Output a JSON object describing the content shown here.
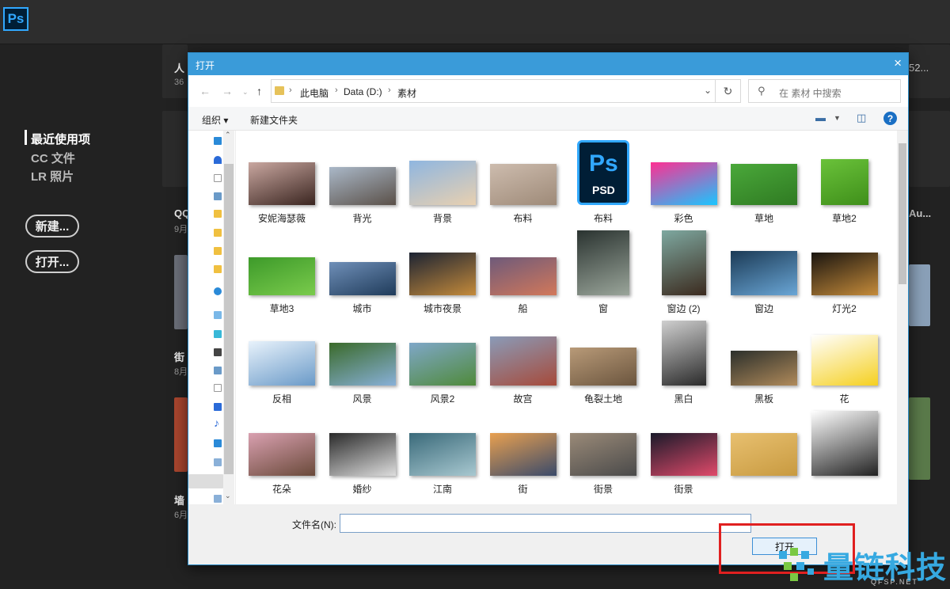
{
  "app": {
    "logo": "Ps"
  },
  "sidebar": {
    "items": [
      {
        "label": "最近使用项",
        "active": true
      },
      {
        "label": "CC 文件",
        "active": false
      },
      {
        "label": "LR 照片",
        "active": false
      }
    ],
    "new_label": "新建...",
    "open_label": "打开..."
  },
  "cards": [
    {
      "name": "人",
      "sub": "36",
      "id": "c1"
    },
    {
      "name": "QQ",
      "sub": "9月",
      "id": "c2"
    },
    {
      "name": "街",
      "sub": "8月",
      "id": "c3"
    },
    {
      "name": "墙",
      "sub": "6月",
      "id": "c4"
    },
    {
      "name": "52...",
      "sub": "",
      "id": "c5"
    },
    {
      "name": "Au...",
      "sub": "",
      "id": "c6"
    }
  ],
  "dialog": {
    "title": "打开",
    "close": "×",
    "breadcrumb": [
      "此电脑",
      "Data (D:)",
      "素材"
    ],
    "search_placeholder": "在 素材 中搜索",
    "organize_label": "组织 ▾",
    "new_folder_label": "新建文件夹",
    "help": "?",
    "filename_label": "文件名(N):",
    "filename_value": "",
    "open_button": "打开",
    "files": [
      {
        "name": "安妮海瑟薇",
        "colors": [
          "#c9a7a0",
          "#3a2520"
        ]
      },
      {
        "name": "背光",
        "colors": [
          "#aab8c8",
          "#5a5048"
        ]
      },
      {
        "name": "背景",
        "colors": [
          "#8fb6e0",
          "#e8d0b0"
        ]
      },
      {
        "name": "布料",
        "colors": [
          "#cdbcae",
          "#9e8a78"
        ]
      },
      {
        "name": "布料",
        "psd": true
      },
      {
        "name": "彩色",
        "colors": [
          "#ff2f92",
          "#19c6ff"
        ]
      },
      {
        "name": "草地",
        "colors": [
          "#4aa83a",
          "#2f7a22"
        ]
      },
      {
        "name": "草地2",
        "colors": [
          "#6ac23a",
          "#3f8f1a"
        ]
      },
      {
        "name": "草地3",
        "colors": [
          "#3d9a2a",
          "#7acb4c"
        ]
      },
      {
        "name": "城市",
        "colors": [
          "#6f8fb8",
          "#1f3b5a"
        ]
      },
      {
        "name": "城市夜景",
        "colors": [
          "#1c2333",
          "#c48a3a"
        ]
      },
      {
        "name": "船",
        "colors": [
          "#6e5a7a",
          "#d2785a"
        ]
      },
      {
        "name": "窗",
        "colors": [
          "#2a3330",
          "#9aa59a"
        ]
      },
      {
        "name": "窗边 (2)",
        "colors": [
          "#7ea8a0",
          "#3b2a1e"
        ]
      },
      {
        "name": "窗边",
        "colors": [
          "#1b3a55",
          "#6aa6d6"
        ]
      },
      {
        "name": "灯光2",
        "colors": [
          "#1a1510",
          "#c58b3a"
        ]
      },
      {
        "name": "反相",
        "colors": [
          "#e8f2fb",
          "#6a9ac8"
        ]
      },
      {
        "name": "风景",
        "colors": [
          "#3a6a2a",
          "#88b0d8"
        ]
      },
      {
        "name": "风景2",
        "colors": [
          "#7fa7c8",
          "#4f8a3a"
        ]
      },
      {
        "name": "故宫",
        "colors": [
          "#8a9bb8",
          "#a64a3a"
        ]
      },
      {
        "name": "龟裂土地",
        "colors": [
          "#b89a78",
          "#6b553e"
        ]
      },
      {
        "name": "黑白",
        "colors": [
          "#cfcfcf",
          "#2a2a2a"
        ]
      },
      {
        "name": "黑板",
        "colors": [
          "#2b2f2b",
          "#b08a5a"
        ]
      },
      {
        "name": "花",
        "colors": [
          "#ffffff",
          "#f5d020"
        ]
      },
      {
        "name": "花朵",
        "colors": [
          "#d9a0b0",
          "#6a4a3a"
        ]
      },
      {
        "name": "婚纱",
        "colors": [
          "#2a2a2a",
          "#dddddd"
        ]
      },
      {
        "name": "江南",
        "colors": [
          "#3a6a7a",
          "#a8c8d0"
        ]
      },
      {
        "name": "街",
        "colors": [
          "#e8a050",
          "#3a4a6a"
        ]
      },
      {
        "name": "街景",
        "colors": [
          "#9a8a78",
          "#4a4a4a"
        ]
      },
      {
        "name": "街景",
        "colors": [
          "#1a1a2a",
          "#e04a6a"
        ]
      },
      {
        "name": "",
        "colors": [
          "#e8c070",
          "#c89a40"
        ]
      },
      {
        "name": "",
        "colors": [
          "#ffffff",
          "#222222"
        ]
      }
    ]
  },
  "watermark": {
    "name": "量链科技",
    "url": "QFSP.NET"
  },
  "colors": {
    "accent": "#3a9bd9",
    "ps_blue": "#31a8ff",
    "highlight": "#e02020"
  }
}
